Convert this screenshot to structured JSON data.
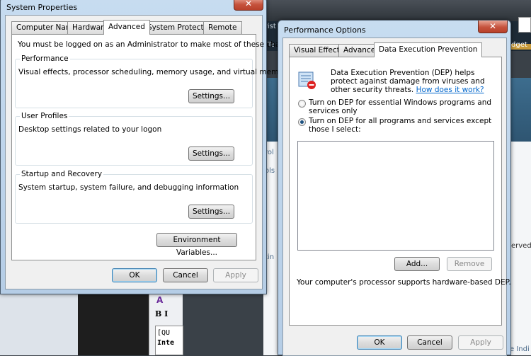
{
  "background": {
    "text_bits": [
      "vist",
      "Te",
      "dget",
      "rol",
      "ols",
      "tin",
      "erved",
      "e Indi"
    ],
    "editor": {
      "toolbar": "B I",
      "content_1": "[QU",
      "content_2": "Inte"
    }
  },
  "system_properties": {
    "title": "System Properties",
    "close_glyph": "✕",
    "tabs": [
      "Computer Name",
      "Hardware",
      "Advanced",
      "System Protection",
      "Remote"
    ],
    "active_tab": "Advanced",
    "admin_note": "You must be logged on as an Administrator to make most of these changes.",
    "performance": {
      "label": "Performance",
      "description": "Visual effects, processor scheduling, memory usage, and virtual memory",
      "button": "Settings..."
    },
    "user_profiles": {
      "label": "User Profiles",
      "description": "Desktop settings related to your logon",
      "button": "Settings..."
    },
    "startup_recovery": {
      "label": "Startup and Recovery",
      "description": "System startup, system failure, and debugging information",
      "button": "Settings..."
    },
    "env_button": "Environment Variables...",
    "ok": "OK",
    "cancel": "Cancel",
    "apply": "Apply"
  },
  "performance_options": {
    "title": "Performance Options",
    "close_glyph": "✕",
    "tabs": [
      "Visual Effects",
      "Advanced",
      "Data Execution Prevention"
    ],
    "active_tab": "Data Execution Prevention",
    "dep_description": "Data Execution Prevention (DEP) helps protect against damage from viruses and other security threats.",
    "dep_link": "How does it work?",
    "option_essential": "Turn on DEP for essential Windows programs and services only",
    "option_all": "Turn on DEP for all programs and services except those I select:",
    "selected_option": "all",
    "add_button": "Add...",
    "remove_button": "Remove",
    "processor_note": "Your computer's processor supports hardware-based DEP.",
    "ok": "OK",
    "cancel": "Cancel",
    "apply": "Apply"
  }
}
